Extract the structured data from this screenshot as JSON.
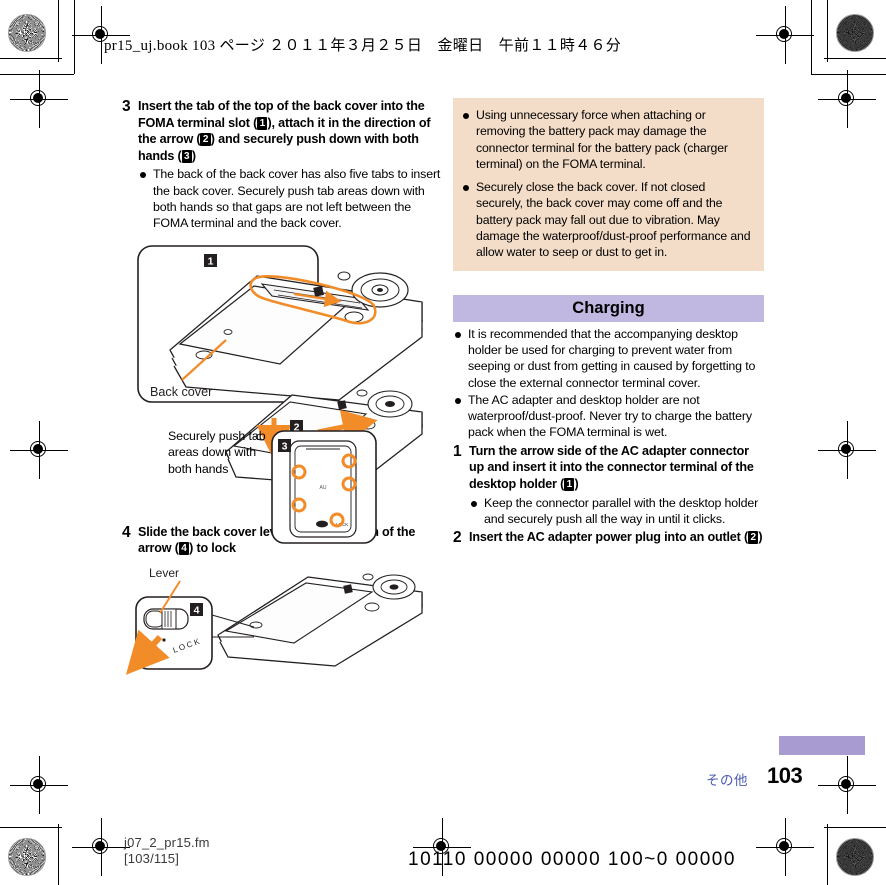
{
  "page": {
    "running_header": "pr15_uj.book  103 ページ  ２０１１年３月２５日　金曜日　午前１１時４６分",
    "page_number": "103",
    "chapter_label": "その他",
    "file_name": "j07_2_pr15.fm",
    "file_pages": "[103/115]",
    "bar_strip": "10110 00000 00000 100~0 00000"
  },
  "colors": {
    "note_box_bg": "#f3ddc8",
    "section_band_bg": "#c0b8e0",
    "footer_bar": "#a79bd1",
    "chapter_text": "#4b5bb0",
    "illustration_accent": "#f28c28"
  },
  "left_column": {
    "step3": {
      "number": "3",
      "text_part1": "Insert the tab of the top of the back cover into the FOMA terminal slot (",
      "badge1": "1",
      "text_part2": "), attach it in the direction of the arrow (",
      "badge2": "2",
      "text_part3": ") and securely push down with both hands (",
      "badge3": "3",
      "text_part4": ")",
      "bullets": [
        "The back of the back cover has also five tabs to insert the back cover. Securely push tab areas down with both hands so that gaps are not left between the FOMA terminal and the back cover."
      ]
    },
    "figure1": {
      "name": "back-cover-attach-illustration",
      "callout_back_cover": "Back cover",
      "callout_push": "Securely push tab areas down with both hands",
      "badges": [
        "1",
        "2",
        "3"
      ]
    },
    "step4": {
      "number": "4",
      "text_part1": "Slide the back cover lever in the direction of the arrow (",
      "badge1": "4",
      "text_part2": ") to lock"
    },
    "figure2": {
      "name": "lever-lock-illustration",
      "callout_lever": "Lever",
      "lock_text": "LOCK",
      "badge": "4"
    }
  },
  "right_column": {
    "note_box": {
      "items": [
        "Using unnecessary force when attaching or removing the battery pack may damage the connector terminal for the battery pack (charger terminal) on the FOMA terminal.",
        "Securely close the back cover. If not closed securely, the back cover may come off and the battery pack may fall out due to vibration. May damage the waterproof/dust-proof performance and allow water to seep or dust to get in."
      ]
    },
    "section_title": "Charging",
    "charging_bullets": [
      "It is recommended that the accompanying desktop holder be used for charging to prevent water from seeping or dust from getting in caused by forgetting to close the external connector terminal cover.",
      "The AC adapter and desktop holder are not waterproof/dust-proof. Never try to charge the battery pack when the FOMA terminal is wet."
    ],
    "step1": {
      "number": "1",
      "text_part1": "Turn the arrow side of the AC adapter connector up and insert it into the connector terminal of the desktop holder (",
      "badge1": "1",
      "text_part2": ")",
      "bullets": [
        "Keep the connector parallel with the desktop holder and securely push all the way in until it clicks."
      ]
    },
    "step2": {
      "number": "2",
      "text_part1": "Insert the AC adapter power plug into an outlet (",
      "badge1": "2",
      "text_part2": ")"
    }
  }
}
